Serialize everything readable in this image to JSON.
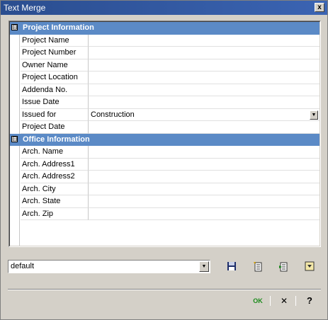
{
  "window": {
    "title": "Text Merge",
    "close_label": "x"
  },
  "grid": {
    "categories": [
      {
        "label": "Project Information",
        "toggle": "⊟",
        "rows": [
          {
            "name": "Project Name",
            "value": ""
          },
          {
            "name": "Project Number",
            "value": ""
          },
          {
            "name": "Owner Name",
            "value": ""
          },
          {
            "name": "Project Location",
            "value": ""
          },
          {
            "name": "Addenda No.",
            "value": ""
          },
          {
            "name": "Issue Date",
            "value": ""
          },
          {
            "name": "Issued for",
            "value": "Construction"
          },
          {
            "name": "Project Date",
            "value": ""
          }
        ]
      },
      {
        "label": "Office Information",
        "toggle": "⊟",
        "rows": [
          {
            "name": "Arch. Name",
            "value": ""
          },
          {
            "name": "Arch. Address1",
            "value": ""
          },
          {
            "name": "Arch. Address2",
            "value": ""
          },
          {
            "name": "Arch. City",
            "value": ""
          },
          {
            "name": "Arch. State",
            "value": ""
          },
          {
            "name": "Arch. Zip",
            "value": ""
          }
        ]
      }
    ]
  },
  "preset": {
    "selected": "default"
  },
  "footer": {
    "ok_label": "OK",
    "cancel_label": "✕",
    "help_label": "?"
  },
  "colors": {
    "category_header": "#5b8ac6",
    "title_bar": "#2a4d8f",
    "ok_green": "#1a8a1a"
  }
}
